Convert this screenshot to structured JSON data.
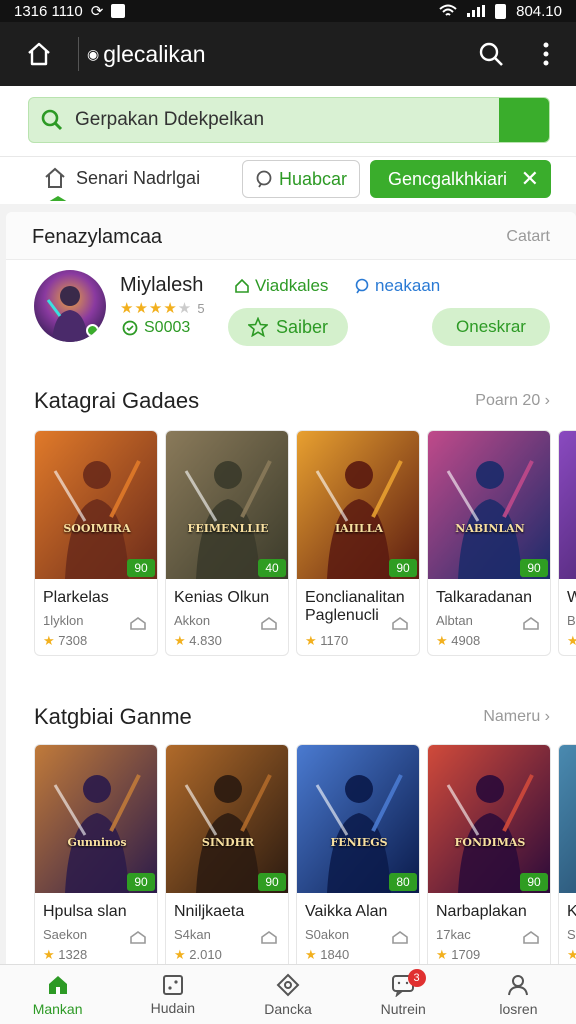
{
  "status_bar": {
    "time": "1316 1110",
    "right_text": "804.10"
  },
  "toolbar": {
    "title": "glecalikan"
  },
  "search": {
    "value": "Gerpakan Ddekpelkan"
  },
  "filters": {
    "home_label": "Senari Nadrlgai",
    "chip_outline": "Huabcar",
    "chip_green": "Gencgalkhkiari"
  },
  "card": {
    "title": "Fenazylamcaa",
    "action": "Catart"
  },
  "profile": {
    "name": "Miylalesh",
    "rating_text": "5",
    "coins": "S0003",
    "link_green": "Viadkales",
    "link_blue": "neakaan",
    "button_left": "Saiber",
    "button_right": "Oneskrar"
  },
  "sections": [
    {
      "title": "Katagrai Gadaes",
      "more": "Poarn 20",
      "games": [
        {
          "name": "Plarkelas",
          "sub": "1lyklon",
          "rating": "7308",
          "badge": "90",
          "art": "SOOIMIRA",
          "palette": [
            "#6a2a1a",
            "#e07a2a"
          ]
        },
        {
          "name": "Kenias Olkun",
          "sub": "Akkon",
          "rating": "4.830",
          "badge": "40",
          "art": "FEIMENLLIE",
          "palette": [
            "#3a3a2a",
            "#8a7a5a"
          ]
        },
        {
          "name": "Eonclianalitan Paglenucli",
          "sub": "",
          "rating": "1170",
          "badge": "90",
          "art": "IAIILLA",
          "palette": [
            "#5a1a10",
            "#e8a030"
          ]
        },
        {
          "name": "Talkaradanan",
          "sub": "Albtan",
          "rating": "4908",
          "badge": "90",
          "art": "NABINLAN",
          "palette": [
            "#1a2a6a",
            "#c04a8a"
          ]
        },
        {
          "name": "Wo",
          "sub": "Bo",
          "rating": "",
          "badge": "",
          "art": "",
          "palette": [
            "#3a1a5a",
            "#8a4ac0"
          ]
        }
      ]
    },
    {
      "title": "Katgbiai Ganme",
      "more": "Nameru",
      "games": [
        {
          "name": "Hpulsa slan",
          "sub": "Saekon",
          "rating": "1328",
          "badge": "90",
          "art": "Gunninos",
          "palette": [
            "#2a1a4a",
            "#c07a3a"
          ]
        },
        {
          "name": "Nniljkaeta",
          "sub": "S4kan",
          "rating": "2.010",
          "badge": "90",
          "art": "SINDHR",
          "palette": [
            "#2a1a10",
            "#b06a2a"
          ]
        },
        {
          "name": "Vaikka Alan",
          "sub": "S0akon",
          "rating": "1840",
          "badge": "80",
          "art": "FENIEGS",
          "palette": [
            "#0a1a4a",
            "#4a7ad0"
          ]
        },
        {
          "name": "Narbaplakan",
          "sub": "17kac",
          "rating": "1709",
          "badge": "90",
          "art": "FONDIMAS",
          "palette": [
            "#2a0a3a",
            "#d04a3a"
          ]
        },
        {
          "name": "Ke",
          "sub": "Sc",
          "rating": "",
          "badge": "",
          "art": "",
          "palette": [
            "#1a3a5a",
            "#4a8ab0"
          ]
        }
      ]
    }
  ],
  "bottom_nav": [
    {
      "label": "Mankan",
      "icon": "home-icon",
      "active": true
    },
    {
      "label": "Hudain",
      "icon": "grid-icon",
      "active": false
    },
    {
      "label": "Dancka",
      "icon": "gamepad-icon",
      "active": false
    },
    {
      "label": "Nutrein",
      "icon": "chat-icon",
      "active": false,
      "badge": "3"
    },
    {
      "label": "losren",
      "icon": "person-icon",
      "active": false
    }
  ],
  "colors": {
    "accent": "#3aad2c",
    "link_blue": "#2a7ad4",
    "star": "#f2b01e",
    "badge_red": "#e03030"
  }
}
